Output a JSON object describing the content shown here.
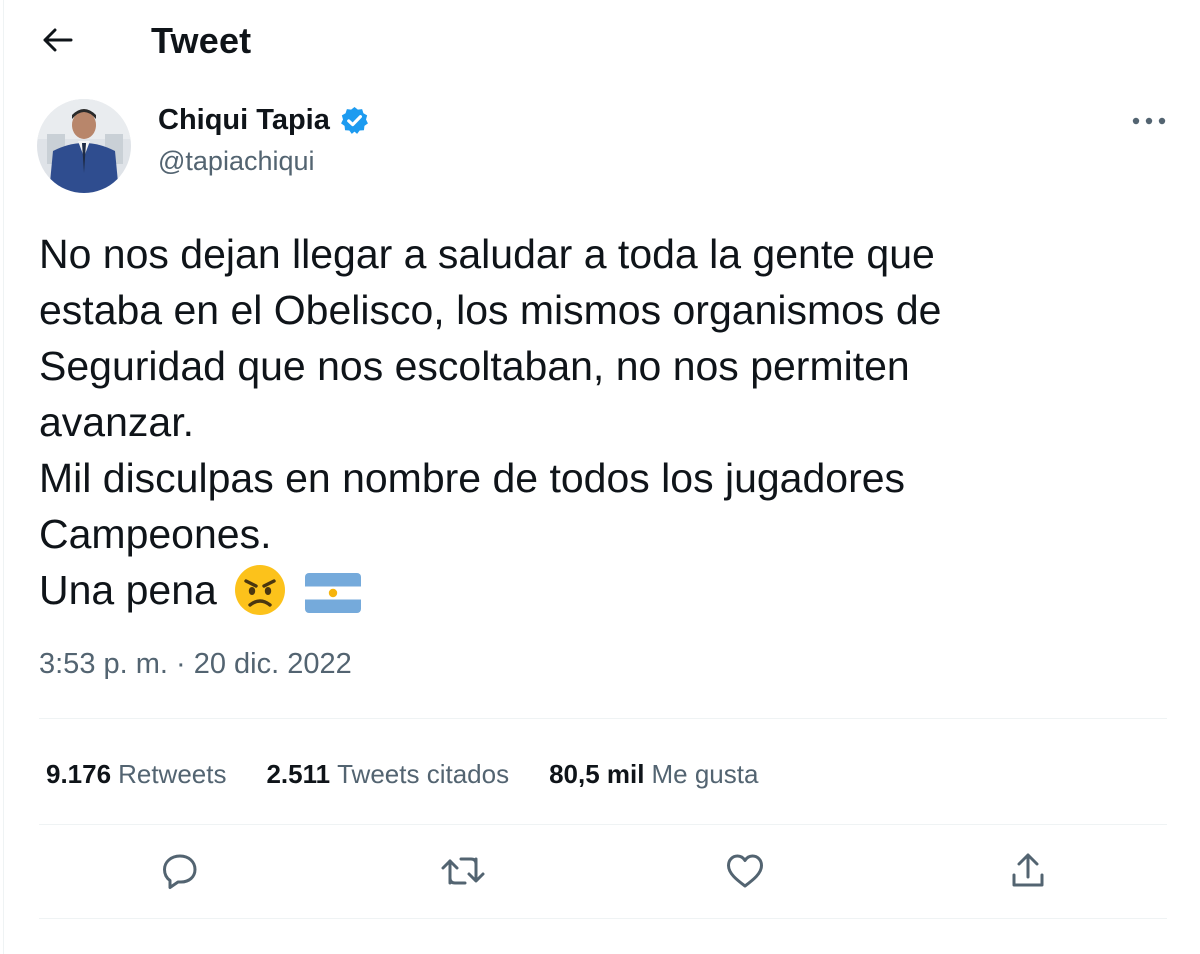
{
  "header": {
    "title": "Tweet",
    "back_icon": "arrow-left-icon"
  },
  "author": {
    "name": "Chiqui Tapia",
    "handle": "@tapiachiqui",
    "verified": true,
    "verified_color": "#1d9bf0"
  },
  "tweet": {
    "lines": [
      "No nos dejan llegar a saludar a toda la gente que",
      "estaba en el Obelisco, los mismos organismos de",
      "Seguridad que nos escoltaban, no nos permiten",
      "avanzar.",
      "Mil disculpas en nombre de todos los jugadores",
      "Campeones.",
      "Una pena"
    ],
    "emojis": [
      "angry-face-emoji",
      "argentina-flag-emoji"
    ],
    "timestamp": "3:53 p. m. · 20 dic. 2022"
  },
  "stats": {
    "retweets": {
      "count": "9.176",
      "label": "Retweets"
    },
    "quotes": {
      "count": "2.511",
      "label": "Tweets citados"
    },
    "likes": {
      "count": "80,5 mil",
      "label": "Me gusta"
    }
  },
  "actions": [
    "reply-icon",
    "retweet-icon",
    "like-icon",
    "share-icon"
  ],
  "colors": {
    "text": "#0f1419",
    "secondary": "#536471",
    "divider": "#eff3f4",
    "accent": "#1d9bf0"
  }
}
